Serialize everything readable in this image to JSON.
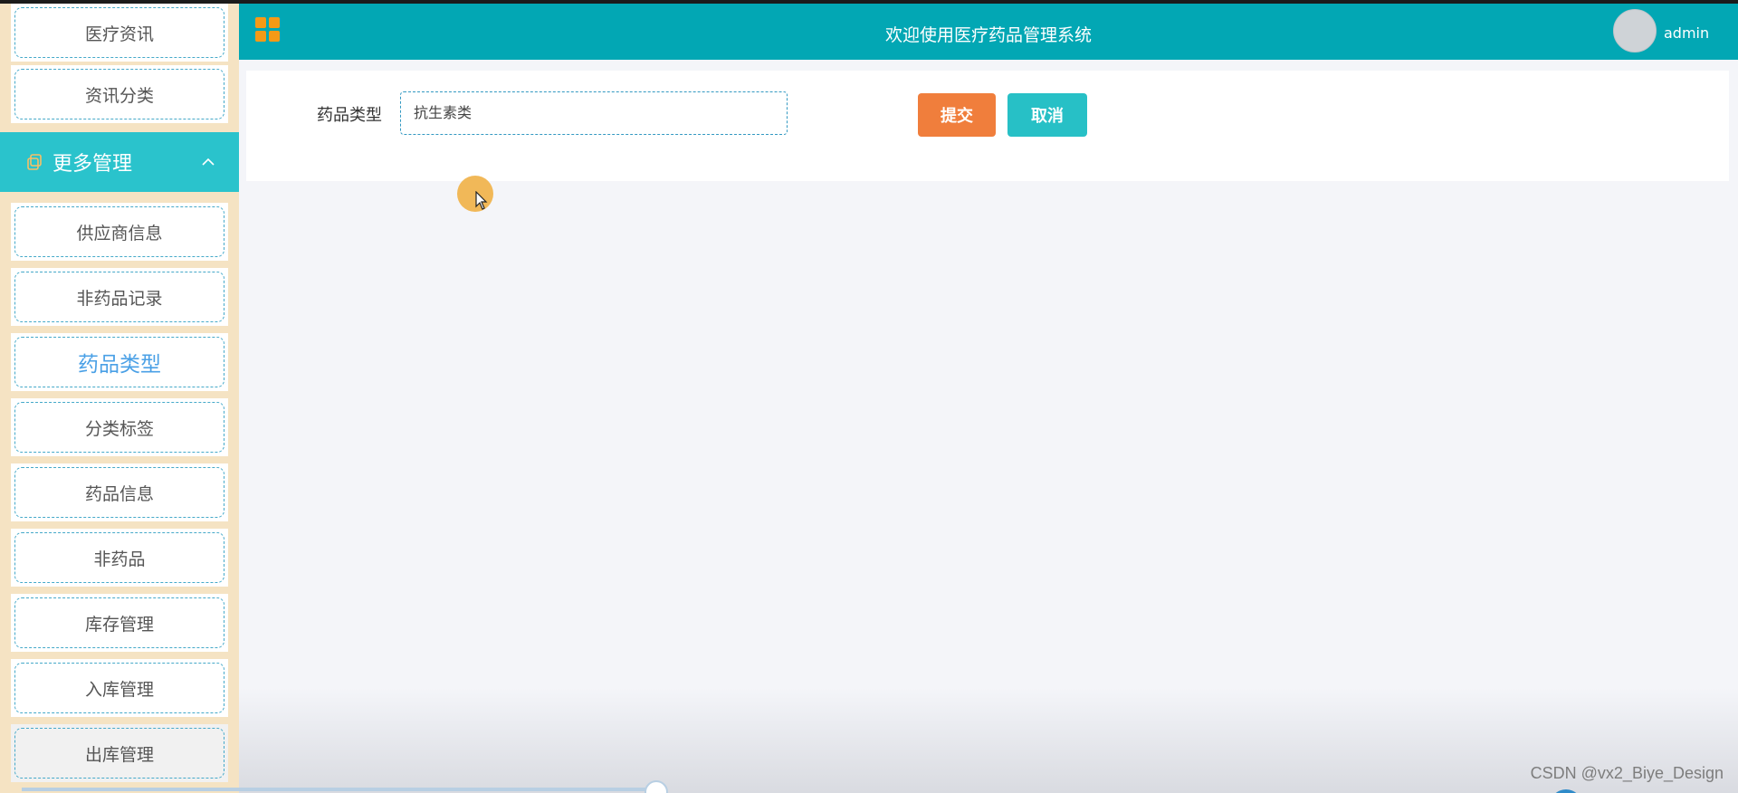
{
  "header": {
    "title": "欢迎使用医疗药品管理系统",
    "username": "admin",
    "accent_color": "#02a7b4"
  },
  "sidebar": {
    "top_items": [
      {
        "label": "医疗资讯"
      },
      {
        "label": "资讯分类"
      }
    ],
    "group": {
      "label": "更多管理",
      "icon": "copy-icon",
      "expanded": true
    },
    "items": [
      {
        "label": "供应商信息"
      },
      {
        "label": "非药品记录"
      },
      {
        "label": "药品类型",
        "active": true
      },
      {
        "label": "分类标签"
      },
      {
        "label": "药品信息"
      },
      {
        "label": "非药品"
      },
      {
        "label": "库存管理"
      },
      {
        "label": "入库管理"
      },
      {
        "label": "出库管理"
      }
    ]
  },
  "form": {
    "field_label": "药品类型",
    "field_value": "抗生素类",
    "submit_label": "提交",
    "cancel_label": "取消"
  },
  "watermark": "CSDN @vx2_Biye_Design"
}
